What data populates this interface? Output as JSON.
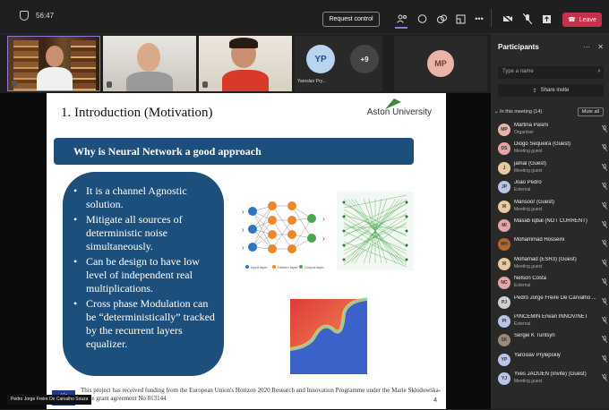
{
  "topbar": {
    "timer": "56:47",
    "request_control": "Request control",
    "leave": "Leave"
  },
  "video_tiles": {
    "yp_initials": "YP",
    "yp_name": "Yaroslav Pry...",
    "overflow": "+9",
    "mp_initials": "MP"
  },
  "slide": {
    "title": "1. Introduction (Motivation)",
    "logo_text": "Aston University",
    "banner": "Why is Neural Network a good approach",
    "bullets": [
      "It is a channel Agnostic solution.",
      "Mitigate all sources of deterministic noise simultaneously.",
      "Can be design to have low level of independent real multiplications.",
      " Cross phase Modulation can be “deterministically” tracked by the recurrent layers equalizer."
    ],
    "funding": "This project has received funding from the European Union's Horizon 2020 Research and Innovation Programme under the Marie Skłodowska-Curie grant agreement No 813144",
    "page_number": "4",
    "nn_legend": [
      "Input layer",
      "Hidden layer",
      "Output layer"
    ]
  },
  "presenter_name": "Pedro Jorge Freire De Carvalho Souza",
  "panel": {
    "title": "Participants",
    "search_placeholder": "Type a name",
    "share_invite": "Share invite",
    "in_meeting": "In this meeting (14)",
    "mute_all": "Mute all",
    "participants": [
      {
        "initials": "MP",
        "name": "Martina Pasini",
        "role": "Organiser",
        "color": "#e8b6a8"
      },
      {
        "initials": "DS",
        "name": "Diogo Sequeira (Guest)",
        "role": "Meeting guest",
        "color": "#e5a5a5"
      },
      {
        "initials": "J",
        "name": "jamal (Guest)",
        "role": "Meeting guest",
        "color": "#e8c9a0"
      },
      {
        "initials": "JP",
        "name": "Joao Pedro",
        "role": "External",
        "color": "#b8c4e8"
      },
      {
        "initials": "M",
        "name": "Mansoor (Guest)",
        "role": "Meeting guest",
        "color": "#e8c9a0"
      },
      {
        "initials": "MI",
        "name": "Masab Iqbal (NOT CURRENT)",
        "role": "",
        "color": "#e5a5a5"
      },
      {
        "initials": "MH",
        "name": "Mohammad Hosseini",
        "role": "",
        "color": "#b06830"
      },
      {
        "initials": "M",
        "name": "Mohamad (ESR3) (Guest)",
        "role": "Meeting guest",
        "color": "#e8c9a0"
      },
      {
        "initials": "NC",
        "name": "Nelson Costa",
        "role": "External",
        "color": "#e5a5a5"
      },
      {
        "initials": "PJ",
        "name": "Pedro Jorge Freire De Carvalho ...",
        "role": "",
        "color": "#d0d0d0"
      },
      {
        "initials": "PI",
        "name": "PINCEMIN Erwan INNOV/NET",
        "role": "External",
        "color": "#b8c4e8"
      },
      {
        "initials": "SK",
        "name": "Sergei K Turitsyn",
        "role": "",
        "color": "#9a8a7a"
      },
      {
        "initials": "YP",
        "name": "Yaroslav Prylepskiy",
        "role": "",
        "color": "#b8c4e8"
      },
      {
        "initials": "YJ",
        "name": "Yves JAOUEN (Invité) (Guest)",
        "role": "Meeting guest",
        "color": "#b8c4e8"
      }
    ]
  }
}
